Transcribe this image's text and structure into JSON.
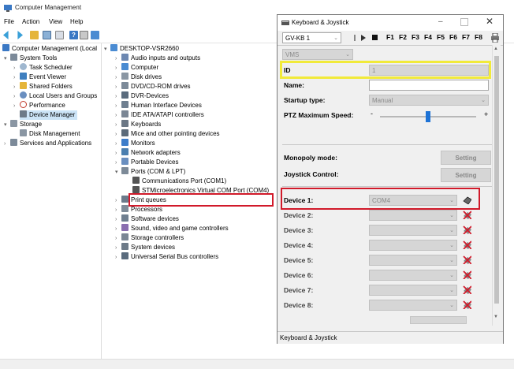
{
  "cm": {
    "title": "Computer Management",
    "menu": [
      "File",
      "Action",
      "View",
      "Help"
    ],
    "left_tree": [
      {
        "label": "Computer Management (Local",
        "indent": 0
      },
      {
        "label": "System Tools",
        "indent": 1
      },
      {
        "label": "Task Scheduler",
        "indent": 2
      },
      {
        "label": "Event Viewer",
        "indent": 2
      },
      {
        "label": "Shared Folders",
        "indent": 2
      },
      {
        "label": "Local Users and Groups",
        "indent": 2
      },
      {
        "label": "Performance",
        "indent": 2
      },
      {
        "label": "Device Manager",
        "indent": 2,
        "selected": true
      },
      {
        "label": "Storage",
        "indent": 1
      },
      {
        "label": "Disk Management",
        "indent": 2
      },
      {
        "label": "Services and Applications",
        "indent": 1
      }
    ],
    "device_tree": {
      "root": "DESKTOP-VSR2660",
      "items": [
        "Audio inputs and outputs",
        "Computer",
        "Disk drives",
        "DVD/CD-ROM drives",
        "DVR-Devices",
        "Human Interface Devices",
        "IDE ATA/ATAPI controllers",
        "Keyboards",
        "Mice and other pointing devices",
        "Monitors",
        "Network adapters",
        "Portable Devices",
        "Ports (COM & LPT)",
        "Communications Port (COM1)",
        "STMicroelectronics Virtual COM Port (COM4)",
        "Print queues",
        "Processors",
        "Software devices",
        "Sound, video and game controllers",
        "Storage controllers",
        "System devices",
        "Universal Serial Bus controllers"
      ]
    }
  },
  "kj": {
    "title": "Keyboard & Joystick",
    "device_select": "GV-KB 1",
    "fkeys": [
      "F1",
      "F2",
      "F3",
      "F4",
      "F5",
      "F6",
      "F7",
      "F8"
    ],
    "vms_select": "VMS",
    "id_label": "ID",
    "id_value": "1",
    "name_label": "Name:",
    "startup_label": "Startup type:",
    "startup_value": "Manual",
    "ptz_label": "PTZ Maximum Speed:",
    "ptz_min": "-",
    "ptz_max": "+",
    "ptz_level": 0.5,
    "monopoly_label": "Monopoly mode:",
    "joystick_label": "Joystick Control:",
    "setting_label": "Setting",
    "devices": [
      {
        "label": "Device 1:",
        "value": "COM4"
      },
      {
        "label": "Device 2:",
        "value": ""
      },
      {
        "label": "Device 3:",
        "value": ""
      },
      {
        "label": "Device 4:",
        "value": ""
      },
      {
        "label": "Device 5:",
        "value": ""
      },
      {
        "label": "Device 6:",
        "value": ""
      },
      {
        "label": "Device 7:",
        "value": ""
      },
      {
        "label": "Device 8:",
        "value": ""
      }
    ],
    "status": "Keyboard & Joystick"
  },
  "colors": {
    "highlight_red": "#d11a2a",
    "highlight_yellow": "#f1ea3a",
    "selection": "#cce4f7"
  }
}
